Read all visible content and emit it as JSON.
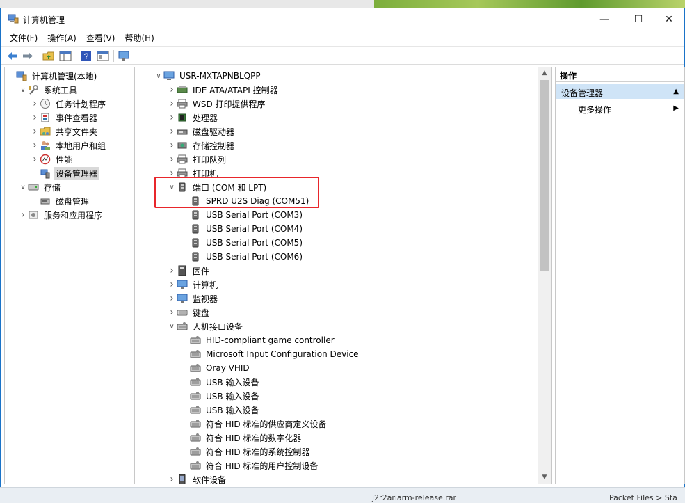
{
  "window": {
    "title": "计算机管理"
  },
  "menu": [
    "文件(F)",
    "操作(A)",
    "查看(V)",
    "帮助(H)"
  ],
  "left_tree": [
    {
      "label": "计算机管理(本地)",
      "icon": "computer-management-icon",
      "indent": 0,
      "arrow": ""
    },
    {
      "label": "系统工具",
      "icon": "tools-icon",
      "indent": 1,
      "arrow": "expanded"
    },
    {
      "label": "任务计划程序",
      "icon": "clock-icon",
      "indent": 2,
      "arrow": "collapsed"
    },
    {
      "label": "事件查看器",
      "icon": "event-viewer-icon",
      "indent": 2,
      "arrow": "collapsed"
    },
    {
      "label": "共享文件夹",
      "icon": "shared-folder-icon",
      "indent": 2,
      "arrow": "collapsed"
    },
    {
      "label": "本地用户和组",
      "icon": "users-icon",
      "indent": 2,
      "arrow": "collapsed"
    },
    {
      "label": "性能",
      "icon": "performance-icon",
      "indent": 2,
      "arrow": "collapsed"
    },
    {
      "label": "设备管理器",
      "icon": "device-manager-icon",
      "indent": 2,
      "arrow": "",
      "selected": true
    },
    {
      "label": "存储",
      "icon": "storage-icon",
      "indent": 1,
      "arrow": "expanded"
    },
    {
      "label": "磁盘管理",
      "icon": "disk-icon",
      "indent": 2,
      "arrow": ""
    },
    {
      "label": "服务和应用程序",
      "icon": "services-icon",
      "indent": 1,
      "arrow": "collapsed"
    }
  ],
  "device_tree": [
    {
      "label": "USR-MXTAPNBLQPP",
      "icon": "computer-icon",
      "indent": 0,
      "arrow": "expanded"
    },
    {
      "label": "IDE ATA/ATAPI 控制器",
      "icon": "ide-controller-icon",
      "indent": 1,
      "arrow": "collapsed"
    },
    {
      "label": "WSD 打印提供程序",
      "icon": "printer-icon",
      "indent": 1,
      "arrow": "collapsed"
    },
    {
      "label": "处理器",
      "icon": "processor-icon",
      "indent": 1,
      "arrow": "collapsed"
    },
    {
      "label": "磁盘驱动器",
      "icon": "disk-drive-icon",
      "indent": 1,
      "arrow": "collapsed"
    },
    {
      "label": "存储控制器",
      "icon": "storage-controller-icon",
      "indent": 1,
      "arrow": "collapsed"
    },
    {
      "label": "打印队列",
      "icon": "printer-icon",
      "indent": 1,
      "arrow": "collapsed"
    },
    {
      "label": "打印机",
      "icon": "printer-icon",
      "indent": 1,
      "arrow": "collapsed"
    },
    {
      "label": "端口 (COM 和 LPT)",
      "icon": "port-icon",
      "indent": 1,
      "arrow": "expanded"
    },
    {
      "label": "SPRD U2S Diag (COM51)",
      "icon": "port-icon",
      "indent": 2,
      "arrow": ""
    },
    {
      "label": "USB Serial Port (COM3)",
      "icon": "port-icon",
      "indent": 2,
      "arrow": ""
    },
    {
      "label": "USB Serial Port (COM4)",
      "icon": "port-icon",
      "indent": 2,
      "arrow": ""
    },
    {
      "label": "USB Serial Port (COM5)",
      "icon": "port-icon",
      "indent": 2,
      "arrow": ""
    },
    {
      "label": "USB Serial Port (COM6)",
      "icon": "port-icon",
      "indent": 2,
      "arrow": ""
    },
    {
      "label": "固件",
      "icon": "firmware-icon",
      "indent": 1,
      "arrow": "collapsed"
    },
    {
      "label": "计算机",
      "icon": "monitor-icon",
      "indent": 1,
      "arrow": "collapsed"
    },
    {
      "label": "监视器",
      "icon": "monitor-icon",
      "indent": 1,
      "arrow": "collapsed"
    },
    {
      "label": "键盘",
      "icon": "keyboard-icon",
      "indent": 1,
      "arrow": "collapsed"
    },
    {
      "label": "人机接口设备",
      "icon": "hid-icon",
      "indent": 1,
      "arrow": "expanded"
    },
    {
      "label": "HID-compliant game controller",
      "icon": "hid-icon",
      "indent": 2,
      "arrow": ""
    },
    {
      "label": "Microsoft Input Configuration Device",
      "icon": "hid-icon",
      "indent": 2,
      "arrow": ""
    },
    {
      "label": "Oray VHID",
      "icon": "hid-icon",
      "indent": 2,
      "arrow": ""
    },
    {
      "label": "USB 输入设备",
      "icon": "hid-icon",
      "indent": 2,
      "arrow": ""
    },
    {
      "label": "USB 输入设备",
      "icon": "hid-icon",
      "indent": 2,
      "arrow": ""
    },
    {
      "label": "USB 输入设备",
      "icon": "hid-icon",
      "indent": 2,
      "arrow": ""
    },
    {
      "label": "符合 HID 标准的供应商定义设备",
      "icon": "hid-icon",
      "indent": 2,
      "arrow": ""
    },
    {
      "label": "符合 HID 标准的数字化器",
      "icon": "hid-icon",
      "indent": 2,
      "arrow": ""
    },
    {
      "label": "符合 HID 标准的系统控制器",
      "icon": "hid-icon",
      "indent": 2,
      "arrow": ""
    },
    {
      "label": "符合 HID 标准的用户控制设备",
      "icon": "hid-icon",
      "indent": 2,
      "arrow": ""
    },
    {
      "label": "软件设备",
      "icon": "software-device-icon",
      "indent": 1,
      "arrow": "collapsed"
    }
  ],
  "actions_pane": {
    "header": "操作",
    "section": "设备管理器",
    "item": "更多操作"
  },
  "taskbar": {
    "left_text": "j2r2ariarm-release.rar",
    "right_text": "Packet Files > Sta"
  },
  "colors": {
    "accent": "#1a73c8",
    "highlight_box": "#e8262b",
    "section_bg": "#cfe4f7"
  }
}
